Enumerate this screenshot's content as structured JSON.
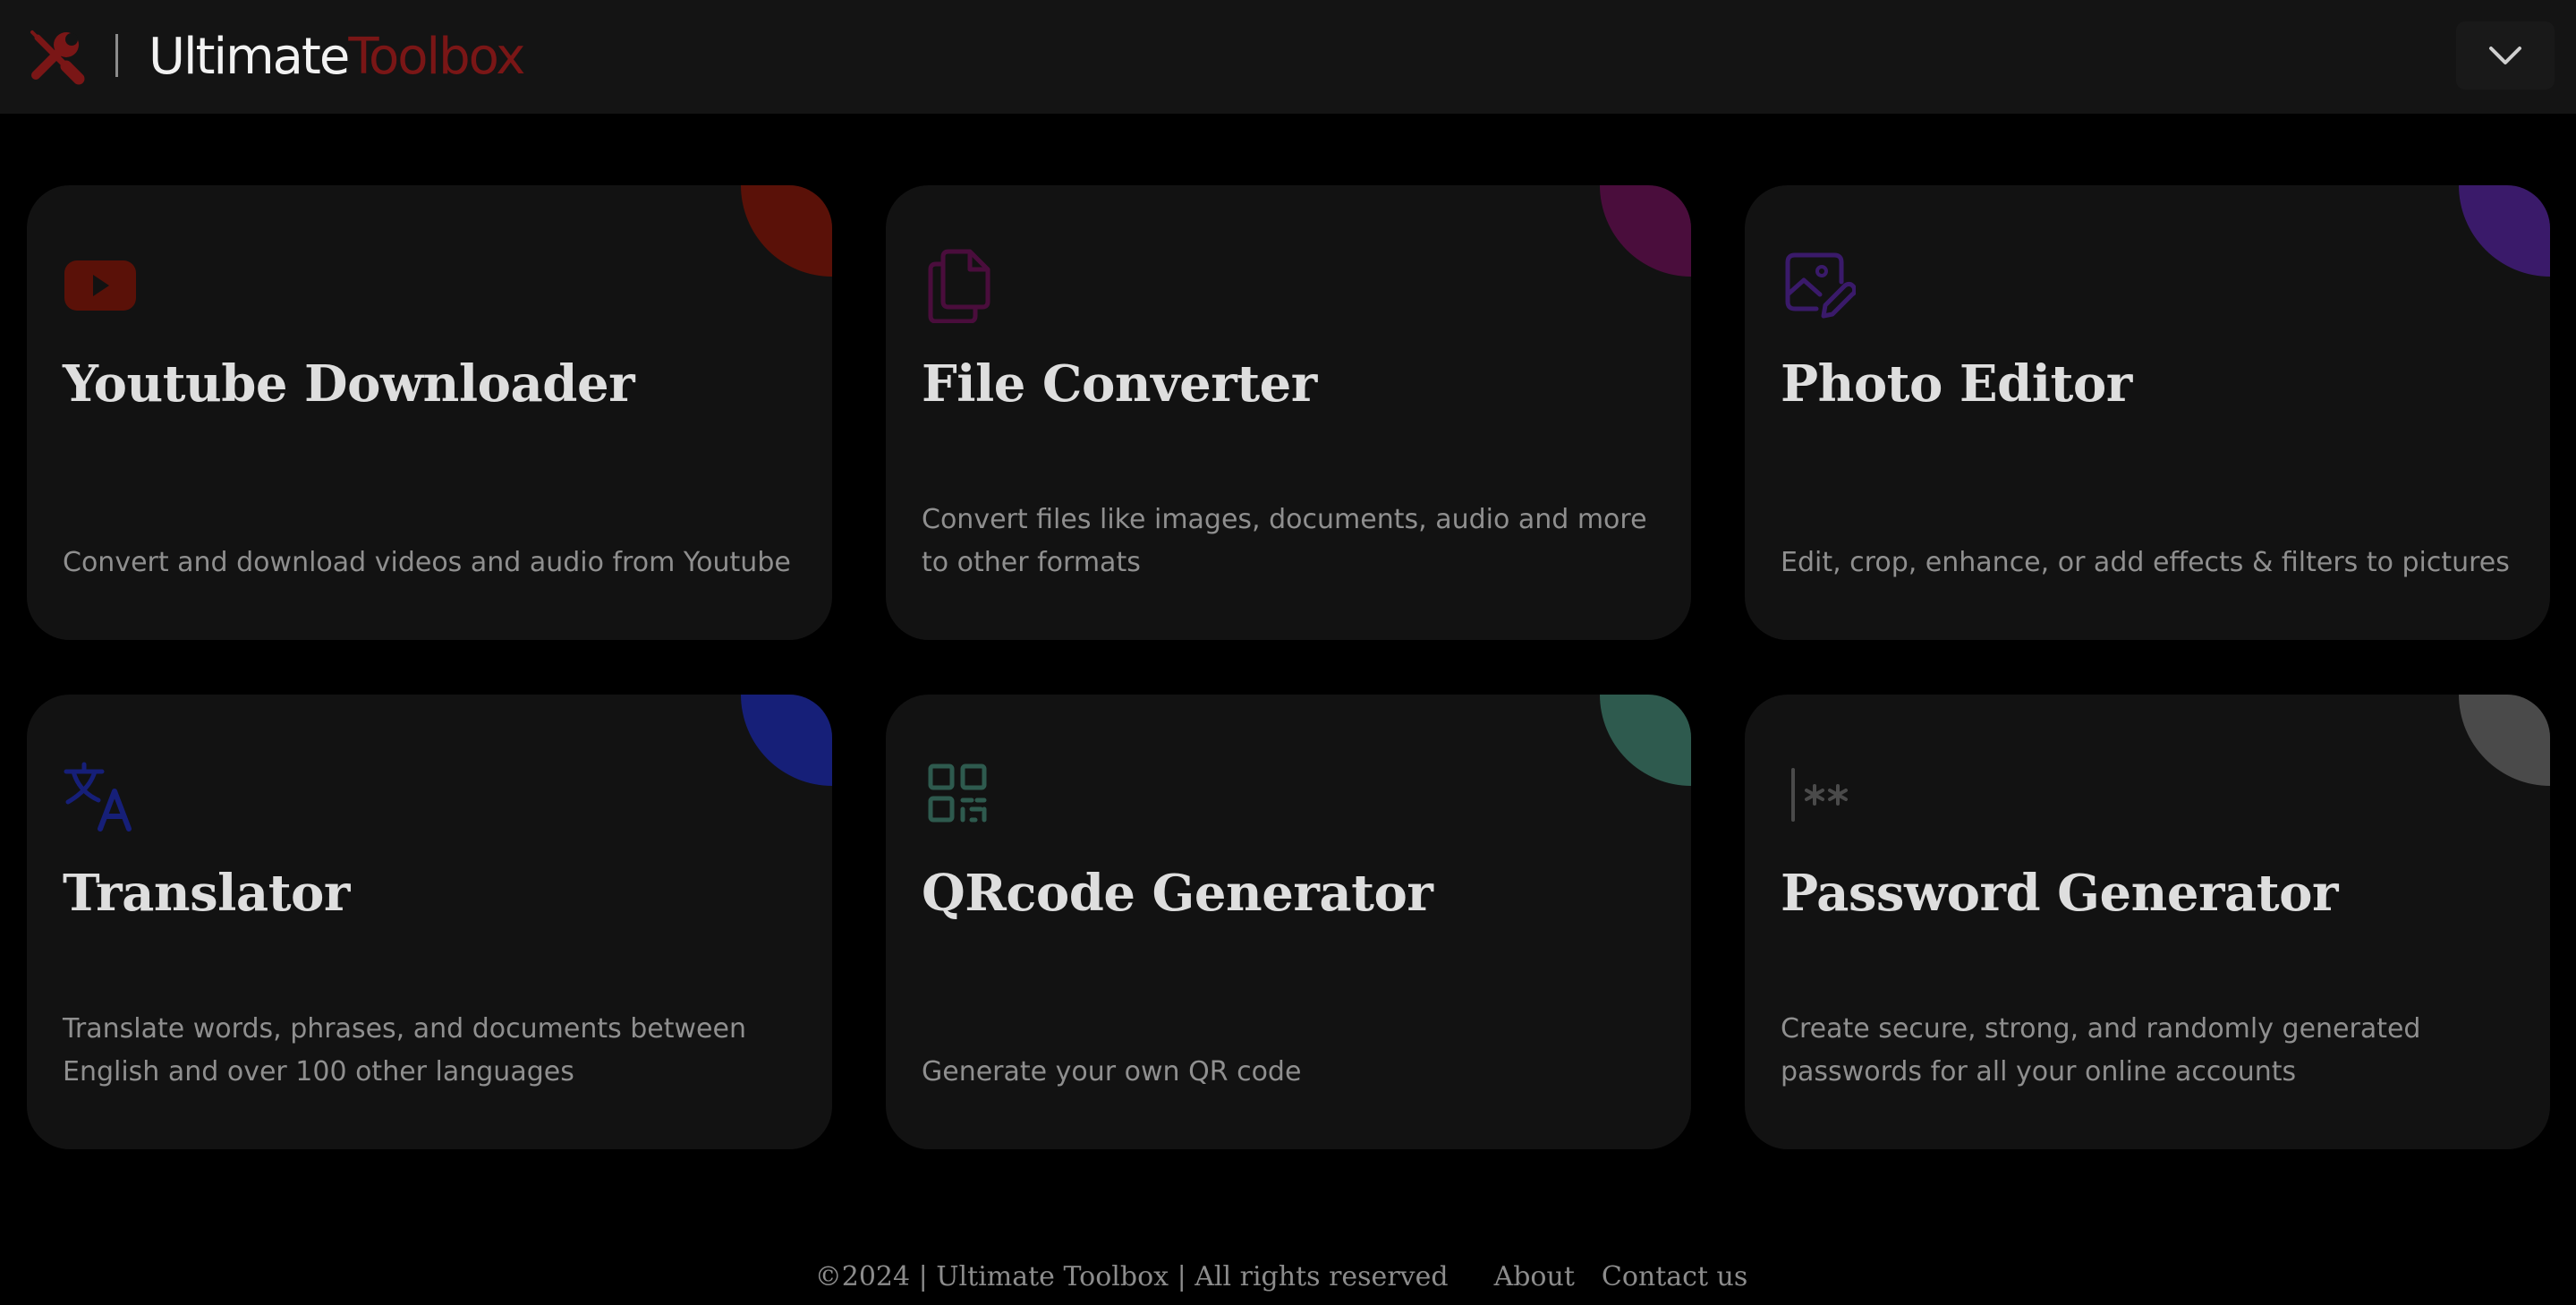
{
  "header": {
    "brand_main": "Ultimate",
    "brand_accent": "Toolbox",
    "logo_icon": "tools-icon",
    "menu_icon": "chevron-down-icon",
    "accent_color": "#7a1616"
  },
  "tools": [
    {
      "title": "Youtube Downloader",
      "description": "Convert and download videos and audio from Youtube",
      "icon": "youtube-icon",
      "accent_color": "#5a1108"
    },
    {
      "title": "File Converter",
      "description": "Convert files like images, documents, audio and more to other formats",
      "icon": "files-icon",
      "accent_color": "#4a0d3c"
    },
    {
      "title": "Photo Editor",
      "description": "Edit, crop, enhance, or add effects & filters to pictures",
      "icon": "photo-edit-icon",
      "accent_color": "#3a1a6a"
    },
    {
      "title": "Translator",
      "description": "Translate words, phrases, and documents between English and over 100 other languages",
      "icon": "translate-icon",
      "accent_color": "#161f78"
    },
    {
      "title": "QRcode Generator",
      "description": "Generate your own QR code",
      "icon": "qr-code-icon",
      "accent_color": "#2e5a4e"
    },
    {
      "title": "Password Generator",
      "description": "Create secure, strong, and randomly generated passwords for all your online accounts",
      "icon": "password-icon",
      "accent_color": "#4a4a4a"
    }
  ],
  "footer": {
    "copyright": "©2024 | Ultimate Toolbox | All rights reserved",
    "about": "About",
    "contact": "Contact us"
  }
}
